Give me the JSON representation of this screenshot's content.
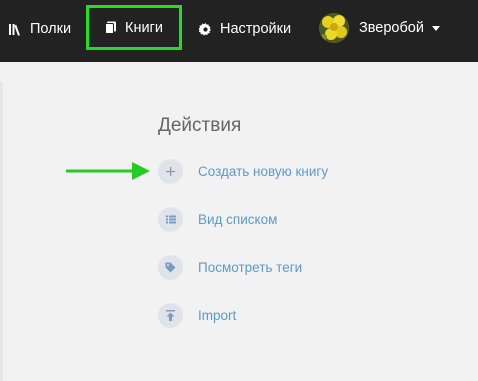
{
  "nav": {
    "shelves_label": "Полки",
    "books_label": "Книги",
    "settings_label": "Настройки",
    "user_name": "Зверобой"
  },
  "main": {
    "actions_title": "Действия",
    "actions": [
      {
        "label": "Создать новую книгу",
        "icon": "plus-icon"
      },
      {
        "label": "Вид списком",
        "icon": "list-icon"
      },
      {
        "label": "Посмотреть теги",
        "icon": "tag-icon"
      },
      {
        "label": "Import",
        "icon": "upload-icon"
      }
    ]
  },
  "colors": {
    "topbar": "#222222",
    "highlight": "#22dd22",
    "link": "#5b9ac9",
    "icon_circle": "#e0e4ea"
  }
}
